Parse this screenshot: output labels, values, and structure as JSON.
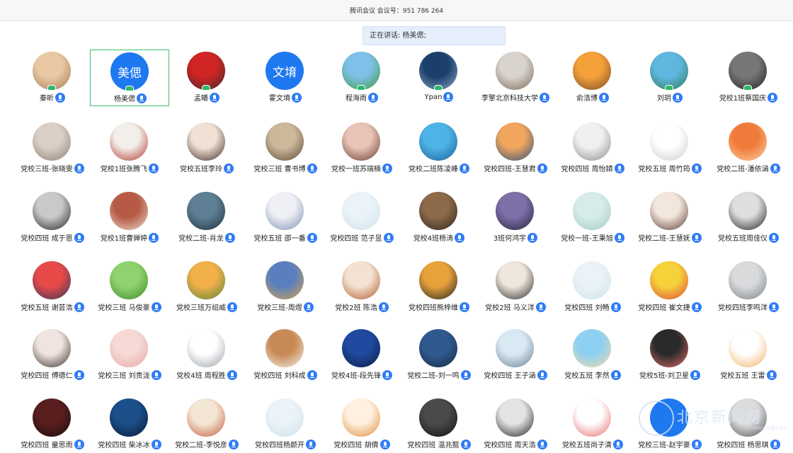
{
  "meeting": {
    "title": "腾讯会议 会议号：951 786 264"
  },
  "speaking_banner": "正在讲话: 杨美偲;",
  "watermark": {
    "text": "北京新闻网",
    "sub": "bjnews.edu.cn"
  },
  "rows": [
    [
      {
        "name": "秦昕",
        "avatar": "photo",
        "colors": [
          "#e8c9a4",
          "#a87a55"
        ],
        "host": true
      },
      {
        "name": "杨美偲",
        "avatar": "text",
        "avatar_text": "美偲",
        "colors": [
          "#1e78f0",
          "#1e78f0"
        ],
        "host": true,
        "active": true
      },
      {
        "name": "孟曦",
        "avatar": "photo",
        "colors": [
          "#d12424",
          "#3b2a26"
        ],
        "host": true
      },
      {
        "name": "霍文堉",
        "avatar": "text",
        "avatar_text": "文堉",
        "colors": [
          "#1e78f0",
          "#1e78f0"
        ],
        "host": false
      },
      {
        "name": "程海雨",
        "avatar": "photo",
        "colors": [
          "#7ec0e8",
          "#3f9a3a"
        ],
        "host": true
      },
      {
        "name": "Ypan",
        "avatar": "photo",
        "colors": [
          "#1b3f6b",
          "#8aa7c7"
        ],
        "host": true
      },
      {
        "name": "李擎北京科技大学",
        "avatar": "photo",
        "colors": [
          "#d8d3cc",
          "#7b6a55"
        ],
        "host": false
      },
      {
        "name": "俞浩博",
        "avatar": "photo",
        "colors": [
          "#f4a13a",
          "#7a4a2a"
        ],
        "host": false
      },
      {
        "name": "刘玥",
        "avatar": "photo",
        "colors": [
          "#5fb7df",
          "#2f7a5a"
        ],
        "host": true
      },
      {
        "name": "党校1班蔡国庆",
        "avatar": "photo",
        "colors": [
          "#777777",
          "#222222"
        ],
        "host": true
      }
    ],
    [
      {
        "name": "党校三班-张晓雯",
        "avatar": "photo",
        "colors": [
          "#d9cfc6",
          "#8d7f72"
        ],
        "host": false
      },
      {
        "name": "党校1班张腾飞",
        "avatar": "photo",
        "colors": [
          "#f2eee9",
          "#b3362a"
        ],
        "host": false
      },
      {
        "name": "党校五班李玲",
        "avatar": "photo",
        "colors": [
          "#f1e1d4",
          "#3a2a22"
        ],
        "host": false
      },
      {
        "name": "党校三班 曹书博",
        "avatar": "photo",
        "colors": [
          "#cdb89a",
          "#5b4a3a"
        ],
        "host": false
      },
      {
        "name": "党校一班苏瑞楠",
        "avatar": "photo",
        "colors": [
          "#e8c4b6",
          "#6a3c2e"
        ],
        "host": false
      },
      {
        "name": "党校二班陈凌峰",
        "avatar": "photo",
        "colors": [
          "#4eb3e6",
          "#1b5e99"
        ],
        "host": false
      },
      {
        "name": "党校四班-王慧君",
        "avatar": "photo",
        "colors": [
          "#f0a65c",
          "#2c4f7f"
        ],
        "host": false
      },
      {
        "name": "党校四班 周怡婧",
        "avatar": "photo",
        "colors": [
          "#f0f0f0",
          "#8a8a8a"
        ],
        "host": false
      },
      {
        "name": "党校五班 周竹筠",
        "avatar": "photo",
        "colors": [
          "#ffffff",
          "#cccccc"
        ],
        "host": false
      },
      {
        "name": "党校二班-潘依涵",
        "avatar": "photo",
        "colors": [
          "#f07a3a",
          "#f5d1a0"
        ],
        "host": false
      }
    ],
    [
      {
        "name": "党校四班 成于恩",
        "avatar": "photo",
        "colors": [
          "#c9c9c9",
          "#222222"
        ],
        "host": false
      },
      {
        "name": "党校1班曹婵婷",
        "avatar": "photo",
        "colors": [
          "#b65a44",
          "#eadccf"
        ],
        "host": false
      },
      {
        "name": "党校二班-肖龙",
        "avatar": "photo",
        "colors": [
          "#5f7f95",
          "#1d2f3c"
        ],
        "host": false
      },
      {
        "name": "党校五班 邵一番",
        "avatar": "photo",
        "colors": [
          "#eef0f5",
          "#7d8db0"
        ],
        "host": false
      },
      {
        "name": "党校四班 范子昱",
        "avatar": "photo",
        "colors": [
          "#eaf3f8",
          "#cfe0ea"
        ],
        "host": false
      },
      {
        "name": "党校4班杨涛",
        "avatar": "photo",
        "colors": [
          "#8c6a4a",
          "#2f241c"
        ],
        "host": false
      },
      {
        "name": "3班何鸿宇",
        "avatar": "photo",
        "colors": [
          "#7f6fa8",
          "#23243f"
        ],
        "host": false
      },
      {
        "name": "党校一班-王秉旭",
        "avatar": "photo",
        "colors": [
          "#d7ecea",
          "#a3c9c2"
        ],
        "host": false
      },
      {
        "name": "党校二班-王慧妩",
        "avatar": "photo",
        "colors": [
          "#f3e6dc",
          "#5a3a30"
        ],
        "host": false
      },
      {
        "name": "党校五班周佳仪",
        "avatar": "photo",
        "colors": [
          "#dedede",
          "#1f1f1f"
        ],
        "host": false
      }
    ],
    [
      {
        "name": "党校五班 谢芸浩",
        "avatar": "photo",
        "colors": [
          "#e84a4a",
          "#2f3b55"
        ],
        "host": false
      },
      {
        "name": "党校三班 马俊豪",
        "avatar": "photo",
        "colors": [
          "#8fd36f",
          "#3e8a2a"
        ],
        "host": false
      },
      {
        "name": "党校三班万绍威",
        "avatar": "photo",
        "colors": [
          "#f2b04a",
          "#58843a"
        ],
        "host": false
      },
      {
        "name": "党校三班-周煜",
        "avatar": "photo",
        "colors": [
          "#5a7fbf",
          "#d6a44a"
        ],
        "host": false
      },
      {
        "name": "党校2班 陈浩",
        "avatar": "photo",
        "colors": [
          "#f3e2d2",
          "#b35a2a"
        ],
        "host": false
      },
      {
        "name": "党校四班熊梓维",
        "avatar": "photo",
        "colors": [
          "#e8a23a",
          "#222222"
        ],
        "host": false
      },
      {
        "name": "党校2班 马义洋",
        "avatar": "photo",
        "colors": [
          "#efe6dc",
          "#2a2a2a"
        ],
        "host": false
      },
      {
        "name": "党校四班 刘畅",
        "avatar": "photo",
        "colors": [
          "#eaf3f8",
          "#cfe0ea"
        ],
        "host": false
      },
      {
        "name": "党校四班 崔文捷",
        "avatar": "photo",
        "colors": [
          "#f5d23a",
          "#e0473a"
        ],
        "host": false
      },
      {
        "name": "党校四班李鸣洋",
        "avatar": "photo",
        "colors": [
          "#d8dadc",
          "#7d8287"
        ],
        "host": false
      }
    ],
    [
      {
        "name": "党校四班 傅德仁",
        "avatar": "photo",
        "colors": [
          "#efe4df",
          "#3a2f2c"
        ],
        "host": false
      },
      {
        "name": "党校三班 刘贵泷",
        "avatar": "photo",
        "colors": [
          "#f7d9d6",
          "#e3a8a3"
        ],
        "host": false
      },
      {
        "name": "党校4班 周程胜",
        "avatar": "photo",
        "colors": [
          "#ffffff",
          "#9aa0a6"
        ],
        "host": false
      },
      {
        "name": "党校四班 刘科成",
        "avatar": "photo",
        "colors": [
          "#c78a55",
          "#f4f1ee"
        ],
        "host": false
      },
      {
        "name": "党校4班-段先锋",
        "avatar": "photo",
        "colors": [
          "#1f4aa0",
          "#0c1c3f"
        ],
        "host": false
      },
      {
        "name": "党校二班-刘一鸣",
        "avatar": "photo",
        "colors": [
          "#2f5a8f",
          "#182c44"
        ],
        "host": false
      },
      {
        "name": "党校四班 王子涵",
        "avatar": "photo",
        "colors": [
          "#d9e9f4",
          "#6a7f90"
        ],
        "host": false
      },
      {
        "name": "党校五班 李然",
        "avatar": "photo",
        "colors": [
          "#8ed0f2",
          "#f4d9a8"
        ],
        "host": false
      },
      {
        "name": "党校5班-刘卫星",
        "avatar": "photo",
        "colors": [
          "#2a2a2a",
          "#e06a6a"
        ],
        "host": false
      },
      {
        "name": "党校五班 王雷",
        "avatar": "photo",
        "colors": [
          "#ffffff",
          "#f0b060"
        ],
        "host": false
      }
    ],
    [
      {
        "name": "党校四班 童思雨",
        "avatar": "photo",
        "colors": [
          "#5a1e1e",
          "#1a0c0c"
        ],
        "host": false
      },
      {
        "name": "党校四班 柴冰冰",
        "avatar": "photo",
        "colors": [
          "#1c4e8a",
          "#061a35"
        ],
        "host": false
      },
      {
        "name": "党校二班-李悦彦",
        "avatar": "photo",
        "colors": [
          "#f4e6d4",
          "#c25a3a"
        ],
        "host": false
      },
      {
        "name": "党校四班杨颜开",
        "avatar": "photo",
        "colors": [
          "#eaf3f8",
          "#cfe0ea"
        ],
        "host": false
      },
      {
        "name": "党校四班 胡倩",
        "avatar": "photo",
        "colors": [
          "#fff1e0",
          "#e08a3a"
        ],
        "host": false
      },
      {
        "name": "党校四班 温兆懿",
        "avatar": "photo",
        "colors": [
          "#4a4a4a",
          "#101010"
        ],
        "host": false
      },
      {
        "name": "党校四班 周天浩",
        "avatar": "photo",
        "colors": [
          "#e4e4e4",
          "#1e1e1e"
        ],
        "host": false
      },
      {
        "name": "党校五班尚子清",
        "avatar": "photo",
        "colors": [
          "#ffffff",
          "#e86a6a"
        ],
        "host": false
      },
      {
        "name": "党校三班-赵宇豪",
        "avatar": "photo",
        "colors": [
          "#1e78f0",
          "#1e78f0"
        ],
        "host": false
      },
      {
        "name": "党校四班 杨思琪",
        "avatar": "photo",
        "colors": [
          "#dcdcdc",
          "#555555"
        ],
        "host": false
      }
    ]
  ]
}
